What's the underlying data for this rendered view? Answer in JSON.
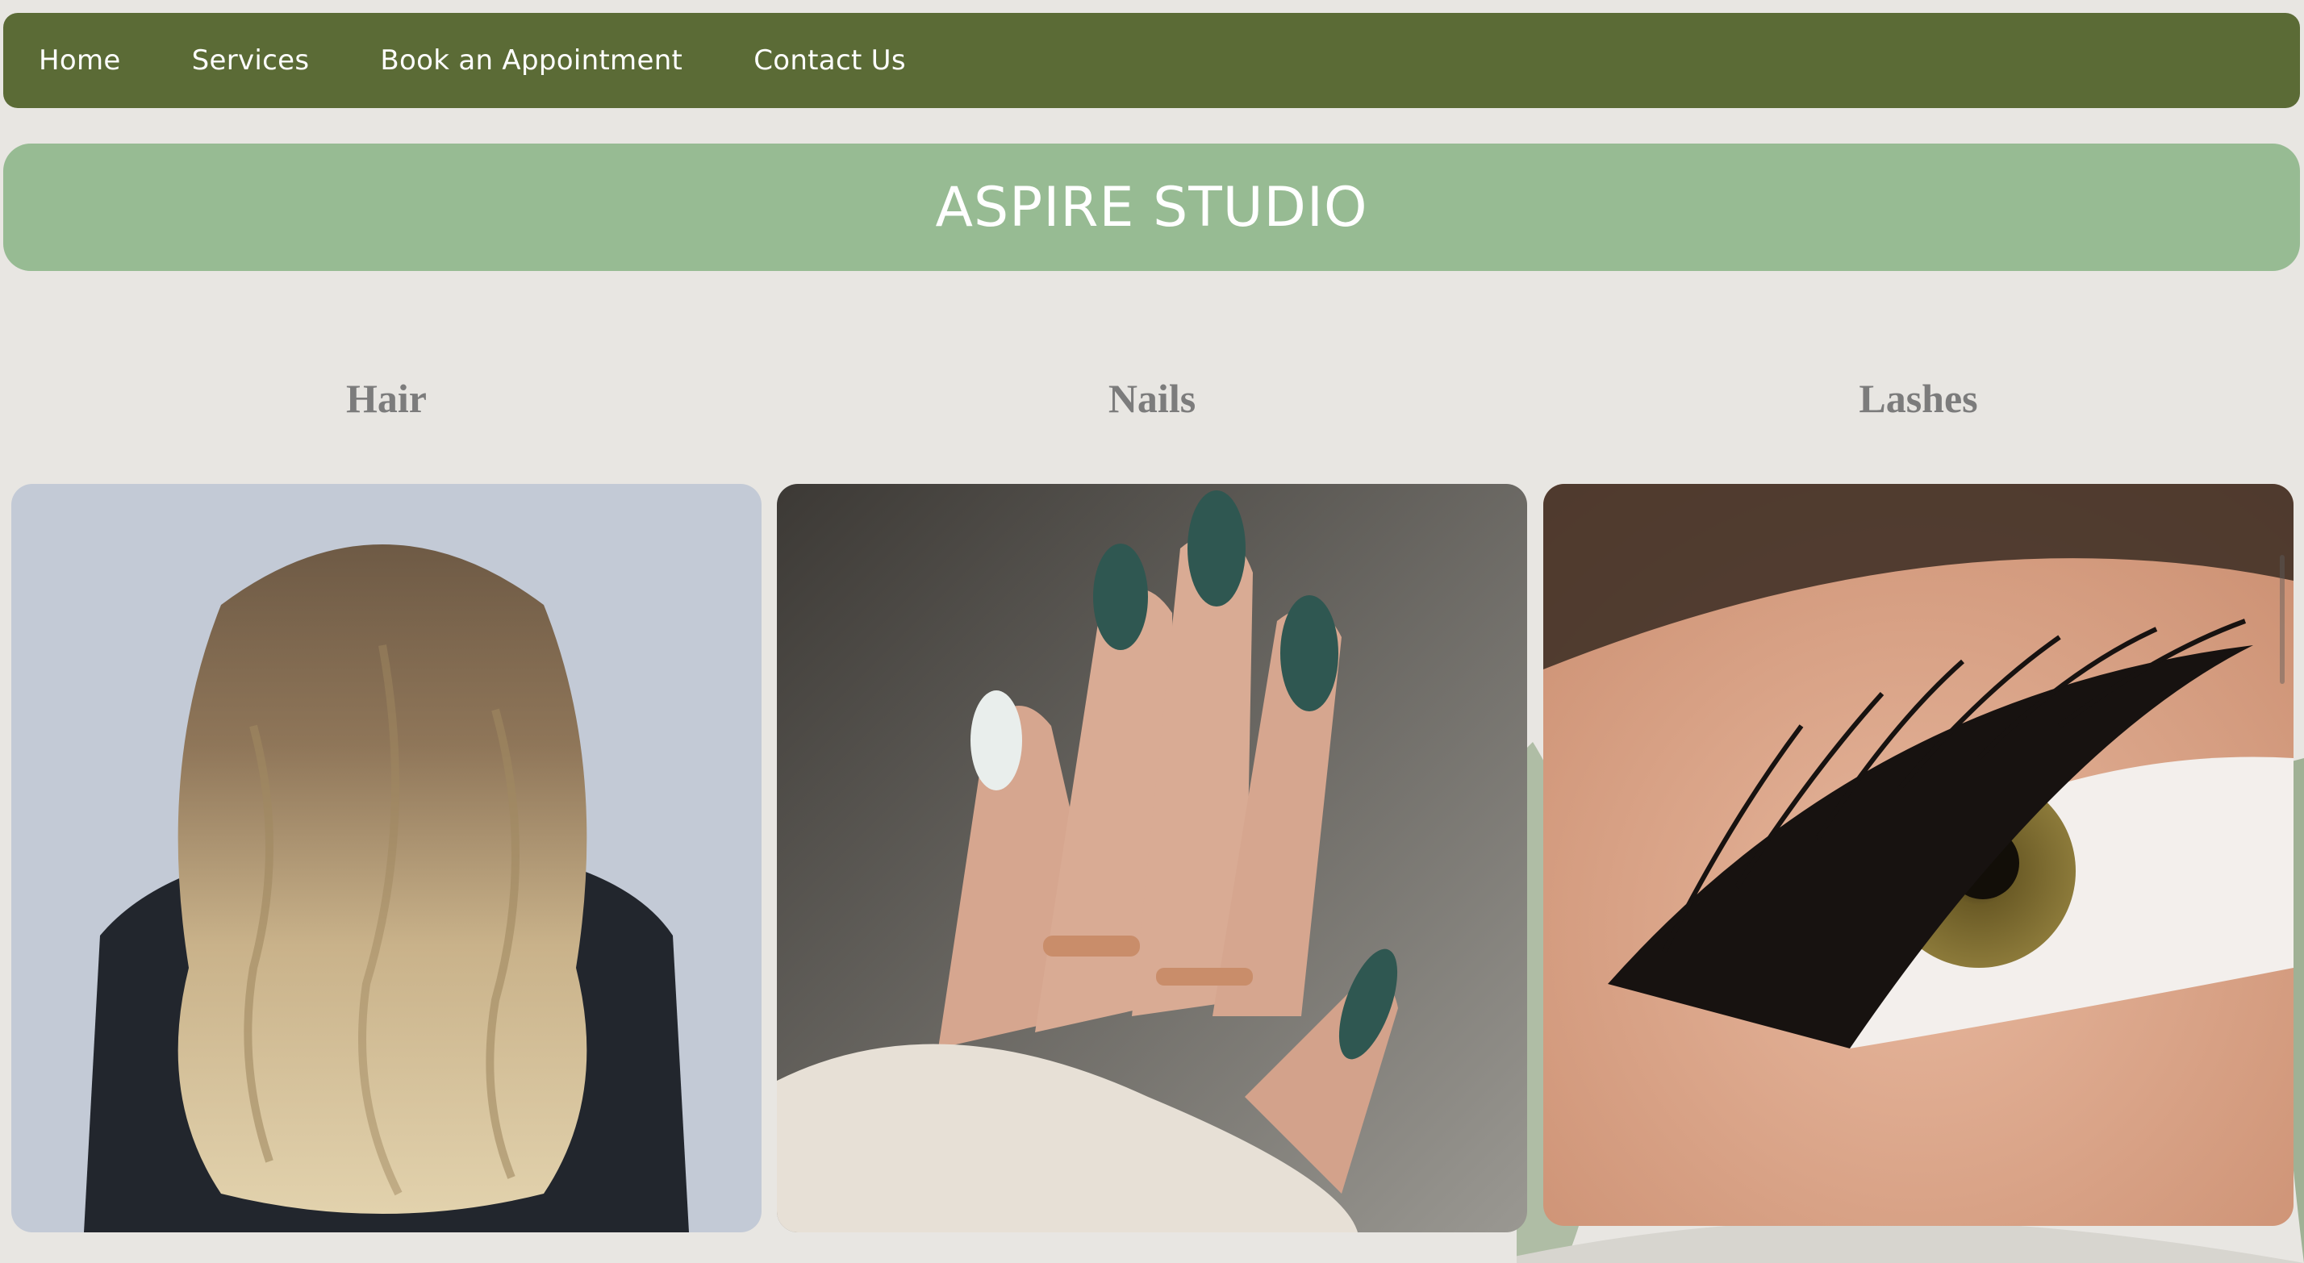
{
  "nav": {
    "items": [
      {
        "label": "Home"
      },
      {
        "label": "Services"
      },
      {
        "label": "Book an Appointment"
      },
      {
        "label": "Contact Us"
      }
    ]
  },
  "banner": {
    "title": "ASPIRE STUDIO"
  },
  "services": [
    {
      "title": "Hair",
      "image": "wavy-balayage-hair-photo"
    },
    {
      "title": "Nails",
      "image": "green-almond-nails-photo"
    },
    {
      "title": "Lashes",
      "image": "eyelash-extension-closeup-photo"
    }
  ],
  "colors": {
    "nav_bg": "#5b6b36",
    "banner_bg": "#97bb93",
    "page_bg": "#e8e6e2",
    "heading_text": "#7c7c7c"
  }
}
